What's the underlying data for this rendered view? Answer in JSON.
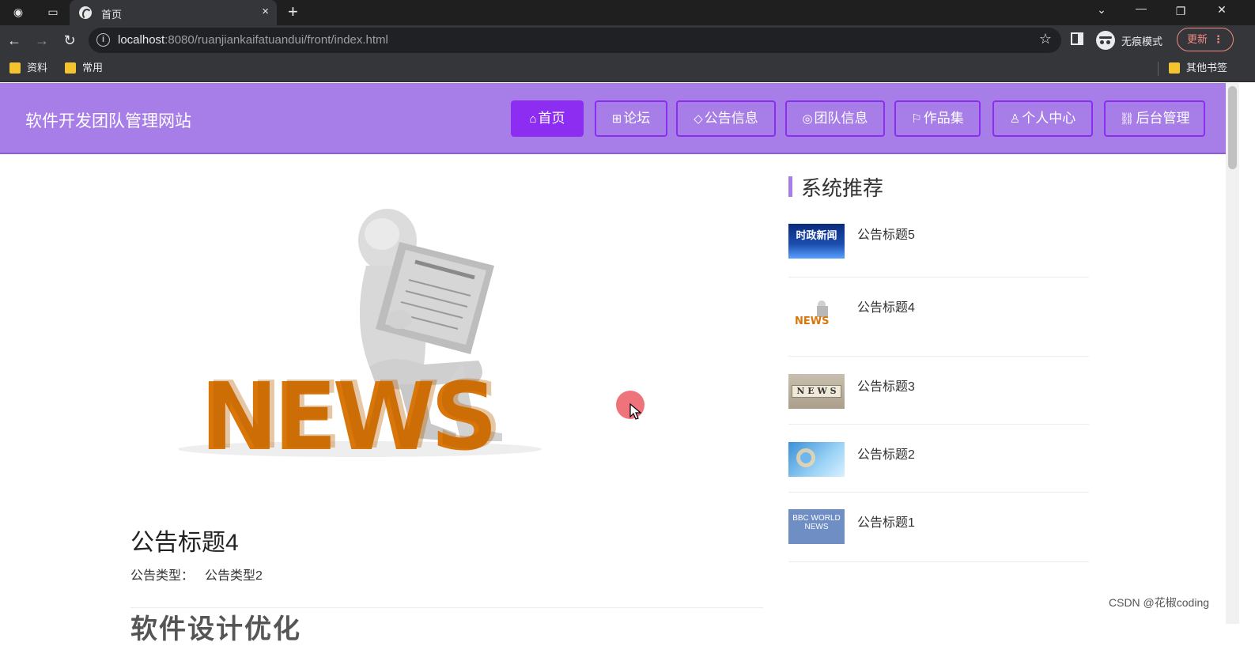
{
  "browser": {
    "tab_title": "首页",
    "tab_close": "×",
    "new_tab": "+",
    "url_host": "localhost",
    "url_rest": ":8080/ruanjiankaifatuandui/front/index.html",
    "incognito_label": "无痕模式",
    "update_label": "更新",
    "bookmarks": [
      "资料",
      "常用"
    ],
    "other_bookmarks": "其他书签"
  },
  "site": {
    "title": "软件开发团队管理网站",
    "accent_color": "#8c2df1",
    "header_color": "#a77ee8",
    "nav": [
      {
        "icon": "⌂",
        "label": "首页",
        "active": true
      },
      {
        "icon": "⊞",
        "label": "论坛"
      },
      {
        "icon": "◇",
        "label": "公告信息"
      },
      {
        "icon": "◎",
        "label": "团队信息"
      },
      {
        "icon": "⚐",
        "label": "作品集"
      },
      {
        "icon": "♙",
        "label": "个人中心"
      },
      {
        "icon": "⛓",
        "label": "后台管理"
      }
    ]
  },
  "article": {
    "hero_text": "NEWS",
    "title": "公告标题4",
    "type_label": "公告类型：",
    "type_value": "公告类型2",
    "cut_heading": "软件设计优化"
  },
  "sidebar": {
    "title": "系统推荐",
    "items": [
      {
        "title": "公告标题5",
        "thumb_text": "时政新闻"
      },
      {
        "title": "公告标题4",
        "thumb_text": "NEWS"
      },
      {
        "title": "公告标题3",
        "thumb_text": "N E W S"
      },
      {
        "title": "公告标题2",
        "thumb_text": ""
      },
      {
        "title": "公告标题1",
        "thumb_text": "BBC WORLD NEWS"
      }
    ]
  },
  "watermark": "CSDN @花椒coding"
}
